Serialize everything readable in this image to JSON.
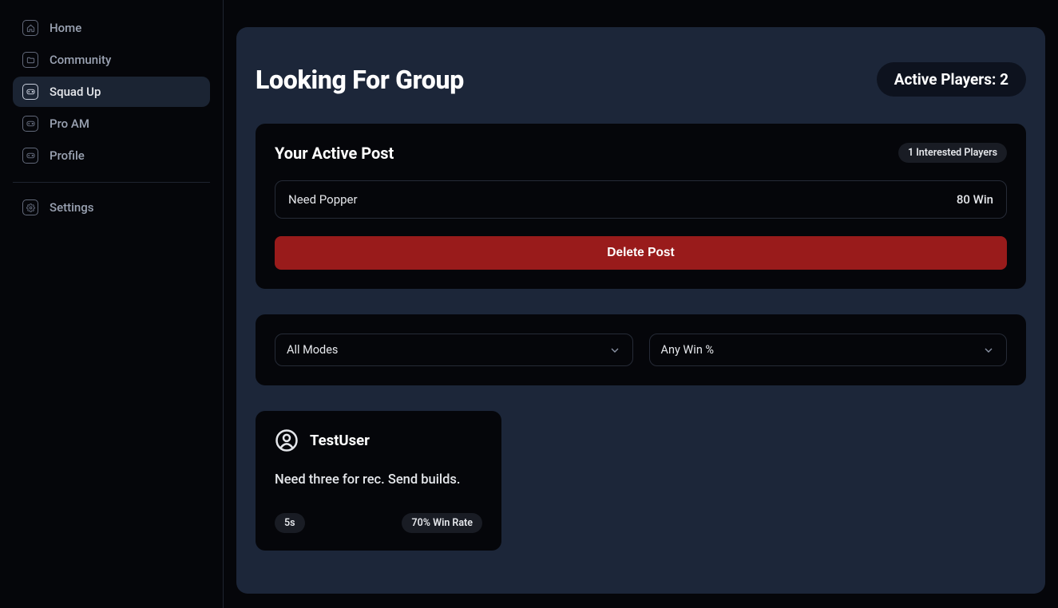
{
  "sidebar": {
    "items": [
      {
        "label": "Home",
        "icon": "home"
      },
      {
        "label": "Community",
        "icon": "folder"
      },
      {
        "label": "Squad Up",
        "icon": "gamepad",
        "active": true
      },
      {
        "label": "Pro AM",
        "icon": "gamepad"
      },
      {
        "label": "Profile",
        "icon": "gamepad"
      }
    ],
    "secondary": [
      {
        "label": "Settings",
        "icon": "gear"
      }
    ]
  },
  "header": {
    "title": "Looking For Group",
    "active_players_label": "Active Players: 2"
  },
  "active_post": {
    "section_title": "Your Active Post",
    "interested_label": "1 Interested Players",
    "text": "Need Popper",
    "win_label": "80 Win",
    "delete_label": "Delete Post"
  },
  "filters": {
    "mode_selected": "All Modes",
    "win_selected": "Any Win %"
  },
  "results": [
    {
      "username": "TestUser",
      "body": "Need three for rec. Send builds.",
      "mode_badge": "5s",
      "winrate_badge": "70% Win Rate"
    }
  ]
}
